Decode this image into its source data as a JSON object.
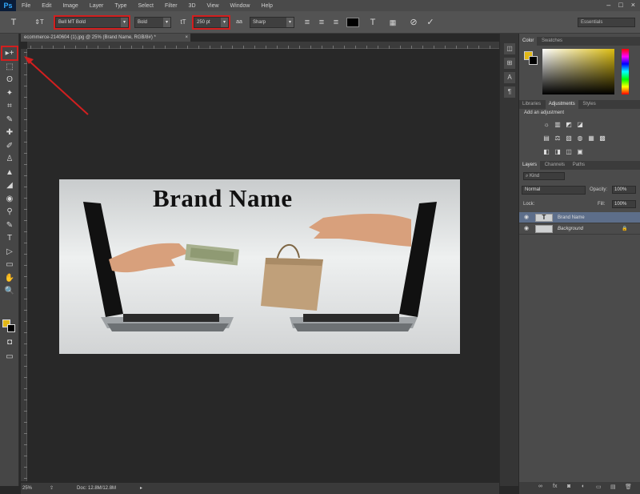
{
  "app": {
    "logo": "Ps",
    "menu": [
      "File",
      "Edit",
      "Image",
      "Layer",
      "Type",
      "Select",
      "Filter",
      "3D",
      "View",
      "Window",
      "Help"
    ],
    "window_controls": [
      "–",
      "□",
      "×"
    ]
  },
  "options_bar": {
    "tool_icon": "T",
    "orient_icon": "⇕T",
    "font_family": "Bell MT Bold",
    "font_style": "Bold",
    "size_icon": "tT",
    "font_size": "250 pt",
    "aa_icon": "aa",
    "antialias": "Sharp",
    "align_left_icon": "≡",
    "align_center_icon": "≡",
    "align_right_icon": "≡",
    "text_color": "#000000",
    "warp_icon": "T",
    "panels_icon": "▦",
    "cancel_icon": "⊘",
    "commit_icon": "✓",
    "workspace": "Essentials"
  },
  "document": {
    "tab_title": "ecommerce-2140604 (1).jpg @ 25% (Brand Name, RGB/8#) *",
    "brand_text": "Brand Name",
    "zoom": "25%",
    "doc_size": "Doc: 12.8M/12.8M"
  },
  "toolbar": {
    "tools": [
      "▸+",
      "⬚",
      "ʘ",
      "✦",
      "⌗",
      "✎",
      "✚",
      "✐",
      "♙",
      "▲",
      "◢",
      "◉",
      "⚲",
      "✎",
      "T",
      "▷",
      "▭",
      "✋",
      "🔍"
    ],
    "quickmask_icon": "◘",
    "screen_mode_icon": "▭"
  },
  "panels": {
    "color_tabs": [
      "Color",
      "Swatches"
    ],
    "adj_tabs": [
      "Libraries",
      "Adjustments",
      "Styles"
    ],
    "adj_title": "Add an adjustment",
    "layers_tabs": [
      "Layers",
      "Channels",
      "Paths"
    ],
    "filter": "Kind",
    "blend_mode": "Normal",
    "opacity_label": "Opacity:",
    "opacity": "100%",
    "lock_label": "Lock:",
    "fill_label": "Fill:",
    "fill": "100%",
    "layers": [
      {
        "name": "Brand Name",
        "thumb": "T",
        "selected": true
      },
      {
        "name": "Background",
        "thumb": "",
        "selected": false
      }
    ],
    "bottom_icons": [
      "∞",
      "fx",
      "◙",
      "◐",
      "▭",
      "▤",
      "🗑"
    ],
    "fg_color": "#e2b817",
    "bg_color": "#000000"
  },
  "accent": {
    "highlight": "#d21f1f",
    "selection": "#5d6e8a"
  }
}
